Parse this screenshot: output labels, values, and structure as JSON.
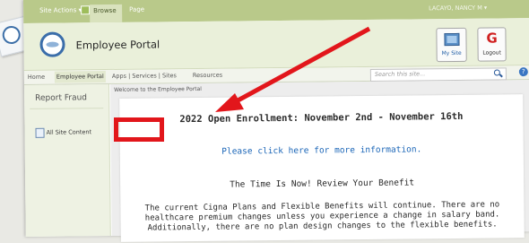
{
  "ribbon": {
    "site_actions": "Site Actions ▾",
    "browse": "Browse",
    "page": "Page",
    "user": "LACAYO, NANCY M ▾"
  },
  "header": {
    "title": "Employee Portal",
    "my_site": "My Site",
    "logout": "Logout"
  },
  "nav": {
    "items": [
      "Home",
      "Employee Portal",
      "Apps | Services | Sites",
      "Resources"
    ],
    "search_placeholder": "Search this site...",
    "help": "?"
  },
  "left_nav": {
    "report_fraud": "Report Fraud",
    "all_site_content": "All Site Content"
  },
  "breadcrumb": "Welcome to the Employee Portal",
  "content": {
    "heading": "2022 Open Enrollment: November 2nd - November 16th",
    "link": "Please click here for more information.",
    "tagline": "The Time Is Now! Review Your Benefit",
    "body": "The current Cigna Plans and Flexible Benefits will continue.  There are no healthcare premium changes unless you experience a change in salary band.  Additionally, there are no plan design changes to the flexible benefits."
  },
  "colors": {
    "ribbon": "#b9c98a",
    "header_bg": "#eaf0da",
    "link": "#1d67b8",
    "annotation": "#e2161b"
  }
}
